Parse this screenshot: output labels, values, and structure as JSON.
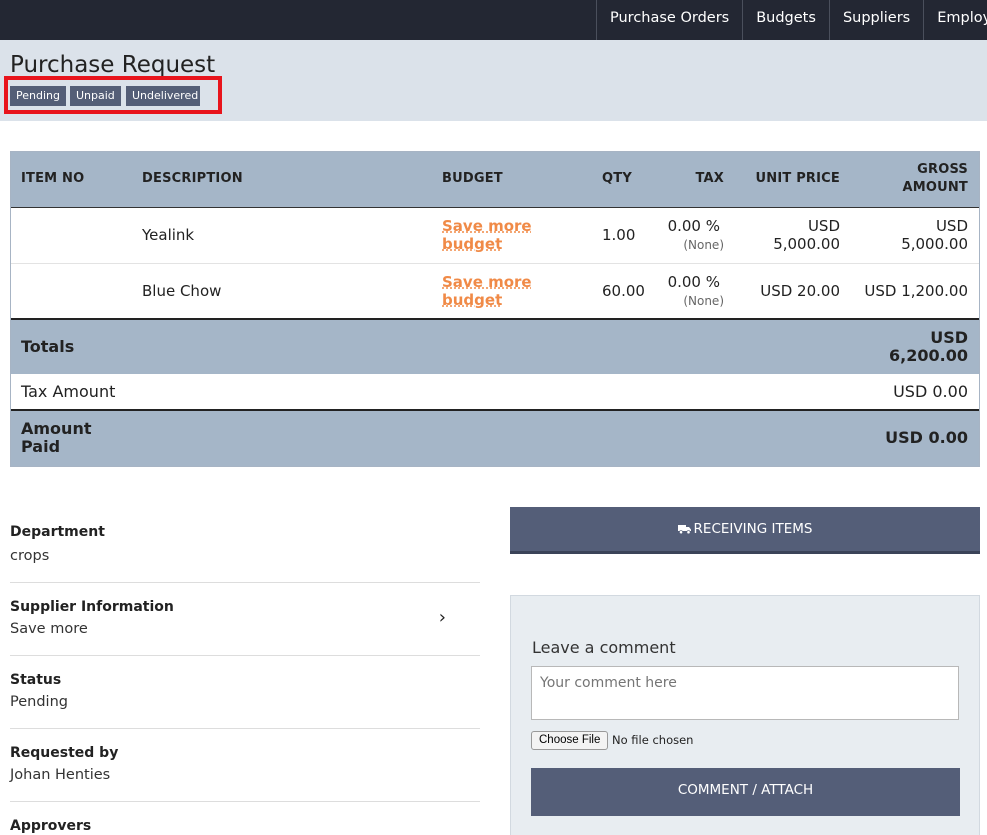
{
  "nav": {
    "items": [
      "Purchase Orders",
      "Budgets",
      "Suppliers",
      "Employ"
    ]
  },
  "header": {
    "title": "Purchase Request",
    "badges": [
      "Pending",
      "Unpaid",
      "Undelivered"
    ]
  },
  "items_table": {
    "headers": {
      "item_no": "ITEM NO",
      "description": "DESCRIPTION",
      "budget": "BUDGET",
      "qty": "QTY",
      "tax": "TAX",
      "unit_price": "UNIT PRICE",
      "gross_amount_1": "GROSS",
      "gross_amount_2": "AMOUNT"
    },
    "rows": [
      {
        "description": "Yealink",
        "budget_1": "Save more",
        "budget_2": "budget",
        "qty": "1.00",
        "tax": "0.00 %",
        "tax_note": "(None)",
        "unit_price_1": "USD",
        "unit_price_2": "5,000.00",
        "gross_1": "USD",
        "gross_2": "5,000.00"
      },
      {
        "description": "Blue Chow",
        "budget_1": "Save more",
        "budget_2": "budget",
        "qty": "60.00",
        "tax": "0.00 %",
        "tax_note": "(None)",
        "unit_price": "USD 20.00",
        "gross": "USD 1,200.00"
      }
    ],
    "totals_label": "Totals",
    "totals_value_1": "USD",
    "totals_value_2": "6,200.00",
    "tax_amount_label": "Tax Amount",
    "tax_amount_value": "USD 0.00",
    "amount_paid_label_1": "Amount",
    "amount_paid_label_2": "Paid",
    "amount_paid_value": "USD 0.00"
  },
  "details": {
    "department_label": "Department",
    "department_value": "crops",
    "supplier_label": "Supplier Information",
    "supplier_value": "Save more",
    "status_label": "Status",
    "status_value": "Pending",
    "requested_label": "Requested by",
    "requested_value": "Johan Henties",
    "approvers_label": "Approvers"
  },
  "actions": {
    "receiving_label": "RECEIVING ITEMS",
    "receiving_icon": "truck-icon",
    "comment_label": "Leave a comment",
    "comment_placeholder": "Your comment here",
    "choose_file_label": "Choose File",
    "no_file_text": "No file chosen",
    "comment_button_label": "COMMENT / ATTACH"
  },
  "colors": {
    "nav_bg": "#232733",
    "header_bg": "#dbe2ea",
    "table_header_bg": "#a5b6c8",
    "badge_bg": "#545e77",
    "highlight_border": "#e8141c",
    "budget_link": "#f08a47",
    "button_bg": "#545e78"
  }
}
